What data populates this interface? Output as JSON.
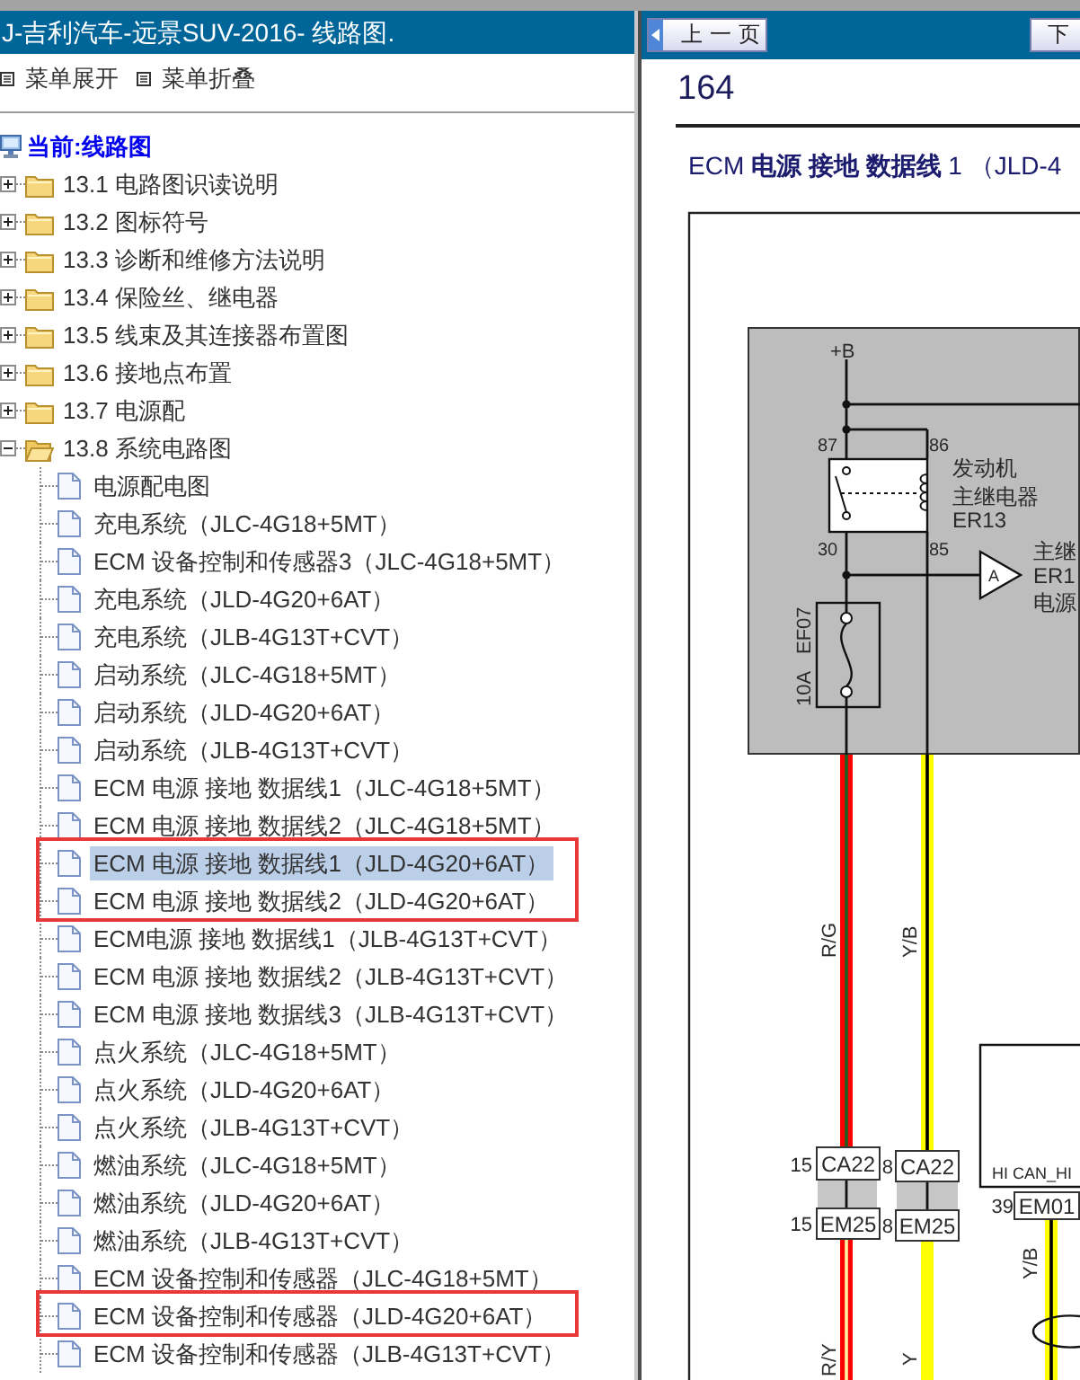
{
  "window": {
    "title": "J-吉利汽车-远景SUV-2016- 线路图."
  },
  "toolbar": [
    {
      "label": "菜单展开"
    },
    {
      "label": "菜单折叠"
    }
  ],
  "tree": {
    "current": "当前:线路图",
    "items": [
      {
        "label": "13.1 电路图识读说明",
        "expanded": false,
        "selected": false
      },
      {
        "label": "13.2 图标符号",
        "expanded": false,
        "selected": false
      },
      {
        "label": "13.3 诊断和维修方法说明",
        "expanded": false,
        "selected": false
      },
      {
        "label": "13.4 保险丝、继电器",
        "expanded": false,
        "selected": false
      },
      {
        "label": "13.5 线束及其连接器布置图",
        "expanded": false,
        "selected": false
      },
      {
        "label": "13.6 接地点布置",
        "expanded": false,
        "selected": false
      },
      {
        "label": "13.7 电源配",
        "expanded": false,
        "selected": false
      },
      {
        "label": "13.8 系统电路图",
        "expanded": true,
        "selected": false,
        "children": [
          {
            "label": "电源配电图",
            "selected": false,
            "marked": false
          },
          {
            "label": "充电系统（JLC-4G18+5MT）",
            "selected": false,
            "marked": false
          },
          {
            "label": "ECM 设备控制和传感器3（JLC-4G18+5MT）",
            "selected": false,
            "marked": false
          },
          {
            "label": "充电系统（JLD-4G20+6AT）",
            "selected": false,
            "marked": false
          },
          {
            "label": "充电系统（JLB-4G13T+CVT）",
            "selected": false,
            "marked": false
          },
          {
            "label": "启动系统（JLC-4G18+5MT）",
            "selected": false,
            "marked": false
          },
          {
            "label": "启动系统（JLD-4G20+6AT）",
            "selected": false,
            "marked": false
          },
          {
            "label": "启动系统（JLB-4G13T+CVT）",
            "selected": false,
            "marked": false
          },
          {
            "label": "ECM 电源 接地 数据线1（JLC-4G18+5MT）",
            "selected": false,
            "marked": false
          },
          {
            "label": "ECM 电源 接地 数据线2（JLC-4G18+5MT）",
            "selected": false,
            "marked": false
          },
          {
            "label": "ECM 电源 接地 数据线1（JLD-4G20+6AT）",
            "selected": true,
            "marked": true
          },
          {
            "label": "ECM 电源 接地 数据线2（JLD-4G20+6AT）",
            "selected": false,
            "marked": true
          },
          {
            "label": "ECM电源 接地 数据线1（JLB-4G13T+CVT）",
            "selected": false,
            "marked": false
          },
          {
            "label": "ECM 电源 接地 数据线2（JLB-4G13T+CVT）",
            "selected": false,
            "marked": false
          },
          {
            "label": "ECM 电源 接地 数据线3（JLB-4G13T+CVT）",
            "selected": false,
            "marked": false
          },
          {
            "label": "点火系统（JLC-4G18+5MT）",
            "selected": false,
            "marked": false
          },
          {
            "label": "点火系统（JLD-4G20+6AT）",
            "selected": false,
            "marked": false
          },
          {
            "label": "点火系统（JLB-4G13T+CVT）",
            "selected": false,
            "marked": false
          },
          {
            "label": "燃油系统（JLC-4G18+5MT）",
            "selected": false,
            "marked": false
          },
          {
            "label": "燃油系统（JLD-4G20+6AT）",
            "selected": false,
            "marked": false
          },
          {
            "label": "燃油系统（JLB-4G13T+CVT）",
            "selected": false,
            "marked": false
          },
          {
            "label": "ECM 设备控制和传感器（JLC-4G18+5MT）",
            "selected": false,
            "marked": false
          },
          {
            "label": "ECM 设备控制和传感器（JLD-4G20+6AT）",
            "selected": false,
            "marked": true
          },
          {
            "label": "ECM 设备控制和传感器（JLB-4G13T+CVT）",
            "selected": false,
            "marked": false
          }
        ]
      }
    ]
  },
  "document": {
    "nav": [
      {
        "kind": "previous",
        "label": "上一页"
      },
      {
        "kind": "next",
        "label": "下"
      }
    ],
    "page_number": "164",
    "title": "ECM **电源 接地 数据线** 1 （JLD-4",
    "diagram": {
      "supply": "+B",
      "relay": {
        "pins": [
          "87",
          "86",
          "30",
          "85"
        ],
        "labels": [
          "发动机",
          "主继电器",
          "ER13"
        ]
      },
      "reference": {
        "letter": "A",
        "labels": [
          "主继",
          "ER1",
          "电源"
        ]
      },
      "fuse": {
        "rating": "10A",
        "code": "EF07"
      },
      "wires": [
        {
          "label": "R/G",
          "color": "#ff0000",
          "stripe": {
            "color": "#1e5e1e"
          }
        },
        {
          "label": "Y/B",
          "color": "#ffff00",
          "stripe": {
            "color": "#000000"
          }
        },
        {
          "label": "R/Y",
          "color": "#ff0000",
          "stripe": {
            "color": "#fff0a0"
          }
        },
        {
          "label": "Y",
          "color": "#ffff00"
        },
        {
          "label": "Y/B",
          "color": "#ffff00",
          "stripe": {
            "color": "#000000"
          }
        }
      ],
      "connectors": [
        {
          "pin": "15",
          "name": "CA22"
        },
        {
          "pin": "8",
          "name": "CA22"
        },
        {
          "pin": "15",
          "name": "EM25"
        },
        {
          "pin": "8",
          "name": "EM25"
        },
        {
          "pin": "39",
          "name": "EM01"
        }
      ],
      "module": {
        "signal": "HI CAN_HI"
      }
    }
  }
}
